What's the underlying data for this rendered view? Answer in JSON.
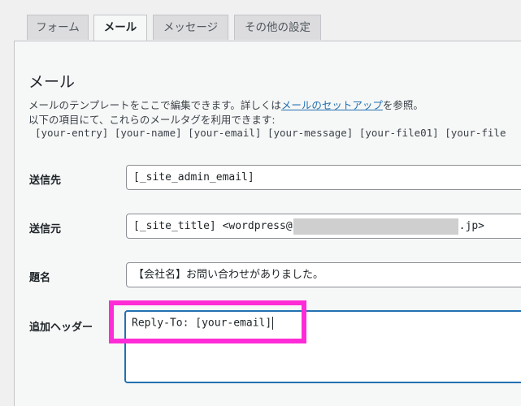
{
  "tabs": [
    {
      "label": "フォーム",
      "active": false
    },
    {
      "label": "メール",
      "active": true
    },
    {
      "label": "メッセージ",
      "active": false
    },
    {
      "label": "その他の設定",
      "active": false
    }
  ],
  "section": {
    "title": "メール",
    "desc_prefix": "メールのテンプレートをここで編集できます。詳しくは",
    "desc_link": "メールのセットアップ",
    "desc_suffix": "を参照。",
    "desc_line2": "以下の項目にて、これらのメールタグを利用できます:",
    "mail_tags": "[your-entry] [your-name] [your-email] [your-message] [your-file01] [your-file"
  },
  "fields": {
    "to": {
      "label": "送信先",
      "value": "[_site_admin_email]"
    },
    "from": {
      "label": "送信元",
      "value_prefix": "[_site_title] <wordpress@",
      "value_suffix": ".jp>"
    },
    "subject": {
      "label": "題名",
      "value": "【会社名】お問い合わせがありました。"
    },
    "headers": {
      "label": "追加ヘッダー",
      "value": "Reply-To: [your-email]"
    }
  },
  "colors": {
    "accent": "#2271b1",
    "highlight": "#ff2bd6"
  }
}
